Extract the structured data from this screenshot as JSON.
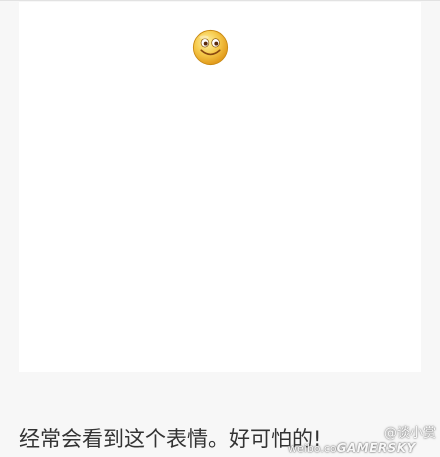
{
  "post": {
    "caption": "经常会看到这个表情。好可怕的!",
    "emoji_name": "smiley-face-icon",
    "colors": {
      "page_background": "#f7f7f7",
      "card_background": "#ffffff",
      "emoji_face": "#f6c94a",
      "emoji_outline": "#c98a14",
      "caption_text": "#333333"
    }
  },
  "watermark": {
    "handle": "@谈小赏",
    "site_prefix": "weibo.co",
    "brand": "GAMERSKY"
  }
}
